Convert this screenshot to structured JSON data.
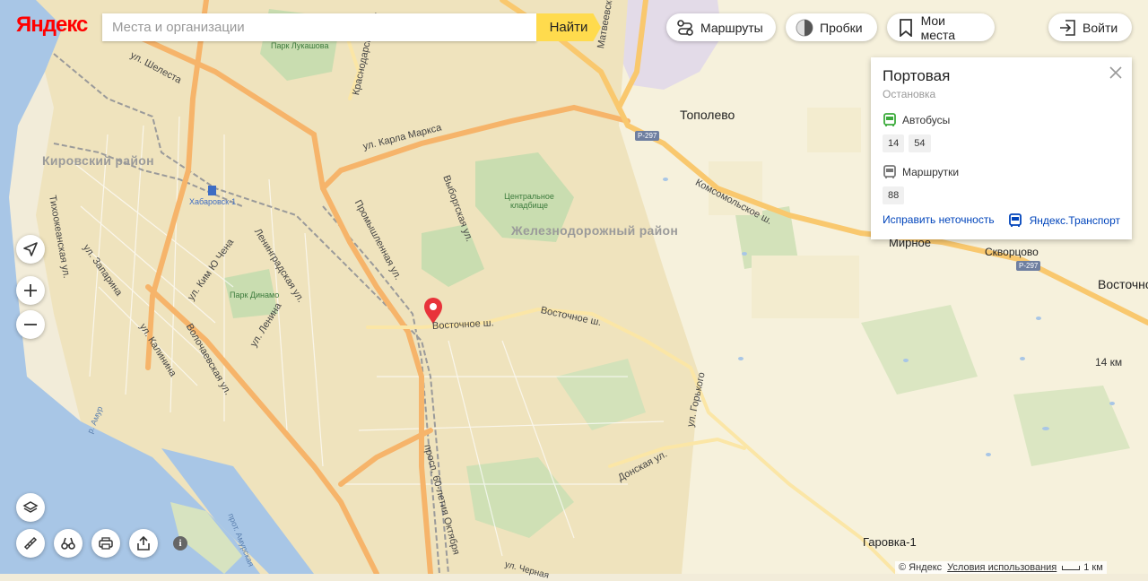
{
  "header": {
    "logo": "Яндекс",
    "search_placeholder": "Места и организации",
    "search_button": "Найти",
    "routes": "Маршруты",
    "traffic": "Пробки",
    "my_places": "Мои места",
    "login": "Войти"
  },
  "map_labels": {
    "districts": [
      "Кировский район",
      "Железнодорожный район"
    ],
    "towns": [
      "Тополево",
      "Мирное",
      "Скворцово",
      "Восточное",
      "Гаровка-1"
    ],
    "streets": [
      "ул. Шелеста",
      "ул. Карла Маркса",
      "Комсомольское ш.",
      "Восточное ш.",
      "Восточное ш.",
      "Тихоокеанская ул.",
      "ул. Запарина",
      "ул. Ким Ю Чена",
      "Ленинградская ул.",
      "ул. Ленина",
      "ул. Калинина",
      "Волочаевская ул.",
      "Промышленная ул.",
      "Выборгская ул.",
      "ул. Горького",
      "Донская ул.",
      "просп. 60-летия Октября",
      "Матвеевское ш.",
      "Краснодарская ул.",
      "ул. Черная",
      "прот. Амурская",
      "р. Амур"
    ],
    "parks": [
      "Парк Лукашова",
      "Центральное кладбище",
      "Парк Динамо"
    ],
    "station": "Хабаровск-1",
    "road_badges": [
      "Р-297",
      "Р-297"
    ],
    "distance": "14 км"
  },
  "card": {
    "title": "Портовая",
    "subtitle": "Остановка",
    "buses_label": "Автобусы",
    "buses": [
      "14",
      "54"
    ],
    "minibuses_label": "Маршрутки",
    "minibuses": [
      "88"
    ],
    "fix_link": "Исправить неточность",
    "transport_link": "Яндекс.Транспорт"
  },
  "footer": {
    "copyright": "© Яндекс",
    "terms": "Условия использования",
    "scale": "1 км"
  },
  "colors": {
    "water": "#a8c6e6",
    "land": "#f2ecd9",
    "city": "#efe5c4",
    "park": "#c9ddb0",
    "major_road": "#f6b46a",
    "highway": "#f9c86e",
    "rail": "#9a9a9a",
    "search_button": "#ffdb4d",
    "marker": "#e8333a",
    "bus": "#3bab3b",
    "link": "#0044bb"
  },
  "icons": [
    "routes-icon",
    "traffic-icon",
    "bookmark-icon",
    "login-icon",
    "close-icon",
    "bus-icon",
    "minibus-icon",
    "location-icon",
    "zoom-in-icon",
    "zoom-out-icon",
    "layers-icon",
    "ruler-icon",
    "binoculars-icon",
    "print-icon",
    "share-icon",
    "info-icon",
    "map-pin-icon"
  ]
}
